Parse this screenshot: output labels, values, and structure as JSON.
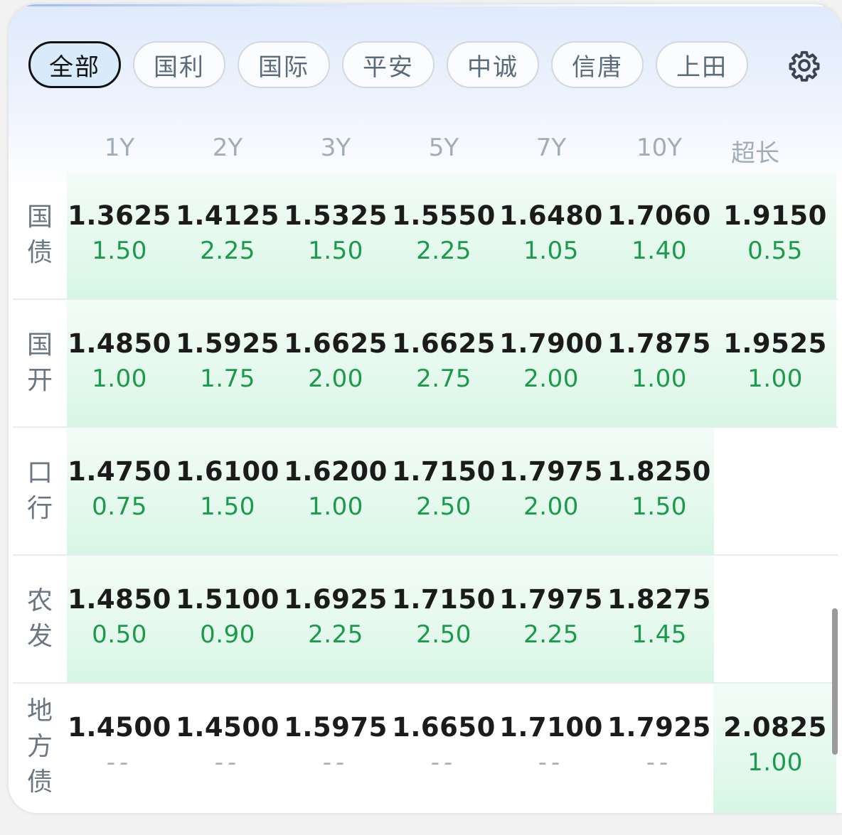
{
  "tabs": [
    {
      "label": "全部",
      "active": true
    },
    {
      "label": "国利",
      "active": false
    },
    {
      "label": "国际",
      "active": false
    },
    {
      "label": "平安",
      "active": false
    },
    {
      "label": "中诚",
      "active": false
    },
    {
      "label": "信唐",
      "active": false
    },
    {
      "label": "上田",
      "active": false
    }
  ],
  "columns": [
    "1Y",
    "2Y",
    "3Y",
    "5Y",
    "7Y",
    "10Y",
    "超长"
  ],
  "rows": [
    {
      "label": "国债",
      "cells": [
        {
          "yield": "1.3625",
          "change": "1.50"
        },
        {
          "yield": "1.4125",
          "change": "2.25"
        },
        {
          "yield": "1.5325",
          "change": "1.50"
        },
        {
          "yield": "1.5550",
          "change": "2.25"
        },
        {
          "yield": "1.6480",
          "change": "1.05"
        },
        {
          "yield": "1.7060",
          "change": "1.40"
        },
        {
          "yield": "1.9150",
          "change": "0.55"
        }
      ]
    },
    {
      "label": "国开",
      "cells": [
        {
          "yield": "1.4850",
          "change": "1.00"
        },
        {
          "yield": "1.5925",
          "change": "1.75"
        },
        {
          "yield": "1.6625",
          "change": "2.00"
        },
        {
          "yield": "1.6625",
          "change": "2.75"
        },
        {
          "yield": "1.7900",
          "change": "2.00"
        },
        {
          "yield": "1.7875",
          "change": "1.00"
        },
        {
          "yield": "1.9525",
          "change": "1.00"
        }
      ]
    },
    {
      "label": "口行",
      "cells": [
        {
          "yield": "1.4750",
          "change": "0.75"
        },
        {
          "yield": "1.6100",
          "change": "1.50"
        },
        {
          "yield": "1.6200",
          "change": "1.00"
        },
        {
          "yield": "1.7150",
          "change": "2.50"
        },
        {
          "yield": "1.7975",
          "change": "2.00"
        },
        {
          "yield": "1.8250",
          "change": "1.50"
        }
      ]
    },
    {
      "label": "农发",
      "cells": [
        {
          "yield": "1.4850",
          "change": "0.50"
        },
        {
          "yield": "1.5100",
          "change": "0.90"
        },
        {
          "yield": "1.6925",
          "change": "2.25"
        },
        {
          "yield": "1.7150",
          "change": "2.50"
        },
        {
          "yield": "1.7975",
          "change": "2.25"
        },
        {
          "yield": "1.8275",
          "change": "1.45"
        }
      ]
    },
    {
      "label": "地方债",
      "cells": [
        {
          "yield": "1.4500",
          "change": "--"
        },
        {
          "yield": "1.4500",
          "change": "--"
        },
        {
          "yield": "1.5975",
          "change": "--"
        },
        {
          "yield": "1.6650",
          "change": "--"
        },
        {
          "yield": "1.7100",
          "change": "--"
        },
        {
          "yield": "1.7925",
          "change": "--"
        },
        {
          "yield": "2.0825",
          "change": "1.00"
        }
      ]
    }
  ],
  "colors": {
    "change_up": "#1c9a4c",
    "accent": "#d9ebfb"
  },
  "icons": {
    "settings": "gear-icon"
  }
}
